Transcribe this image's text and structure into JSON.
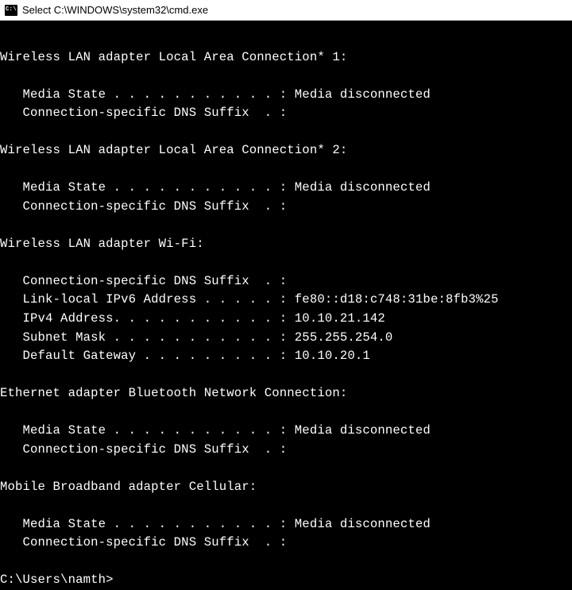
{
  "titlebar": {
    "icon_label": "C:\\",
    "title": "Select C:\\WINDOWS\\system32\\cmd.exe"
  },
  "adapters": [
    {
      "name": "Wireless LAN adapter Local Area Connection* 1:",
      "fields": [
        {
          "label": "Media State . . . . . . . . . . .",
          "value": "Media disconnected"
        },
        {
          "label": "Connection-specific DNS Suffix  .",
          "value": ""
        }
      ]
    },
    {
      "name": "Wireless LAN adapter Local Area Connection* 2:",
      "fields": [
        {
          "label": "Media State . . . . . . . . . . .",
          "value": "Media disconnected"
        },
        {
          "label": "Connection-specific DNS Suffix  .",
          "value": ""
        }
      ]
    },
    {
      "name": "Wireless LAN adapter Wi-Fi:",
      "fields": [
        {
          "label": "Connection-specific DNS Suffix  .",
          "value": ""
        },
        {
          "label": "Link-local IPv6 Address . . . . .",
          "value": "fe80::d18:c748:31be:8fb3%25"
        },
        {
          "label": "IPv4 Address. . . . . . . . . . .",
          "value": "10.10.21.142"
        },
        {
          "label": "Subnet Mask . . . . . . . . . . .",
          "value": "255.255.254.0"
        },
        {
          "label": "Default Gateway . . . . . . . . .",
          "value": "10.10.20.1"
        }
      ]
    },
    {
      "name": "Ethernet adapter Bluetooth Network Connection:",
      "fields": [
        {
          "label": "Media State . . . . . . . . . . .",
          "value": "Media disconnected"
        },
        {
          "label": "Connection-specific DNS Suffix  .",
          "value": ""
        }
      ]
    },
    {
      "name": "Mobile Broadband adapter Cellular:",
      "fields": [
        {
          "label": "Media State . . . . . . . . . . .",
          "value": "Media disconnected"
        },
        {
          "label": "Connection-specific DNS Suffix  .",
          "value": ""
        }
      ]
    }
  ],
  "prompt": "C:\\Users\\namth>"
}
